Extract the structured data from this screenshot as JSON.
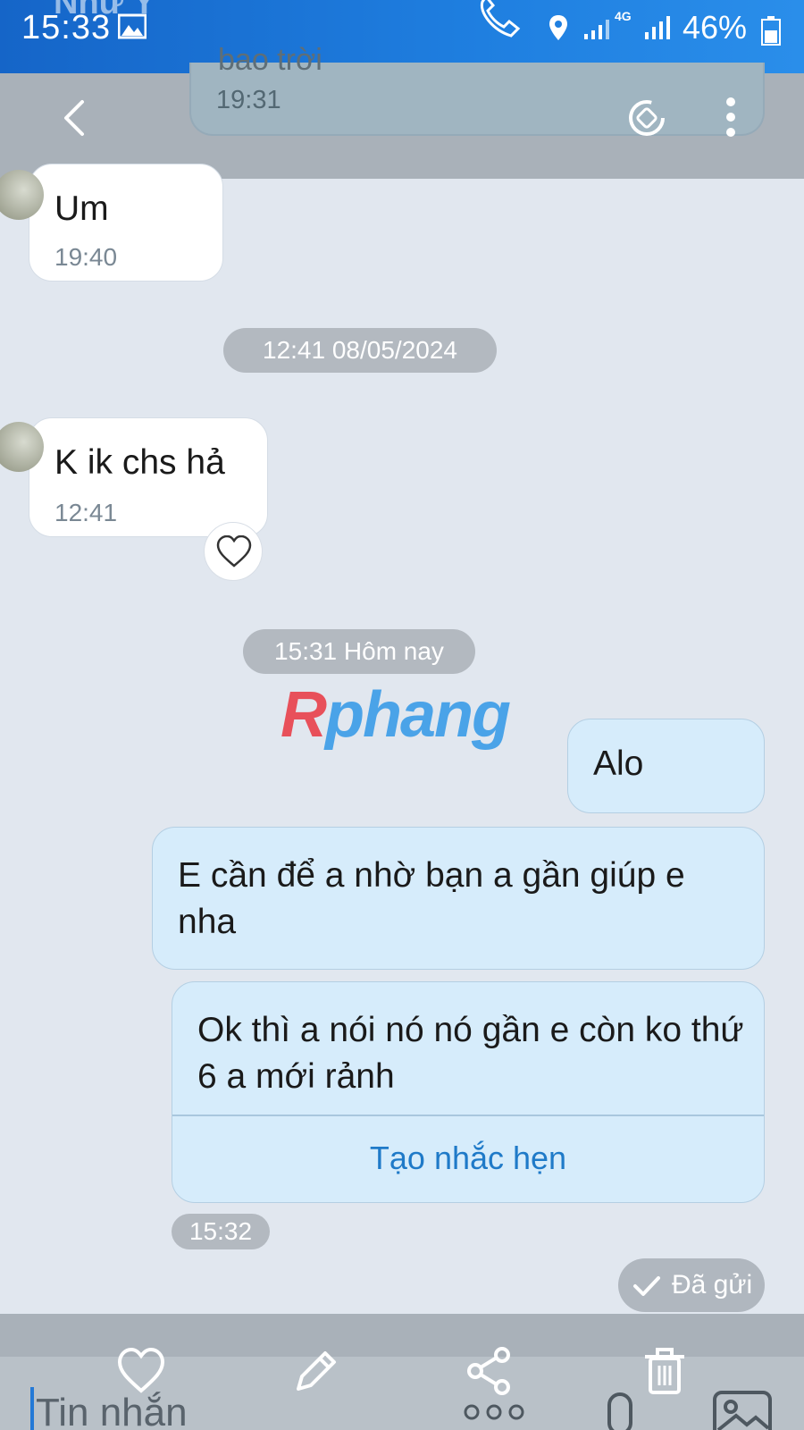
{
  "status_bar": {
    "time": "15:33",
    "contact_name": "Như Ý",
    "battery": "46%",
    "network": "4G"
  },
  "header": {
    "pinned_text_cut": "bao trời",
    "pinned_time": "19:31"
  },
  "messages": [
    {
      "direction": "in",
      "text": "Um",
      "time": "19:40"
    },
    {
      "direction": "in",
      "text": "K ik chs hả",
      "time": "12:41"
    },
    {
      "direction": "out",
      "text": "Alo"
    },
    {
      "direction": "out",
      "text": "E cần để a nhờ bạn a gần giúp e nha"
    },
    {
      "direction": "out",
      "text": "Ok thì a nói nó nó gần e còn ko thứ 6 a mới rảnh",
      "action": "Tạo nhắc hẹn"
    }
  ],
  "separators": {
    "date1": "12:41 08/05/2024",
    "date2": "15:31 Hôm nay"
  },
  "last_time": "15:32",
  "sent_status": "Đã gửi",
  "watermark": {
    "part1": "R",
    "part2": "phang"
  },
  "input": {
    "placeholder": "Tin nhắn"
  },
  "colors": {
    "status_bar": "#1f7fe0",
    "outgoing_bubble": "#d6ecfb",
    "link": "#1f7ac8",
    "background": "#e1e7ef"
  }
}
